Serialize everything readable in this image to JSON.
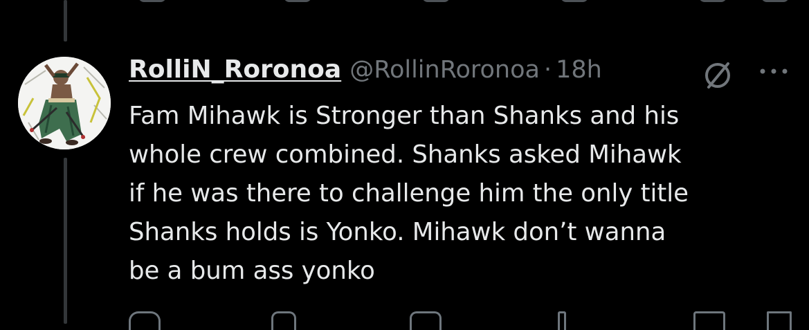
{
  "tweet": {
    "display_name": "RolliN_Roronoa",
    "handle": "@RollinRoronoa",
    "separator": "·",
    "time": "18h",
    "text": "Fam Mihawk is Stronger than Shanks and his\nwhole crew combined. Shanks asked Mihawk\nif he was there to challenge him the only title\nShanks holds is Yonko. Mihawk don’t wanna\nbe a bum ass yonko",
    "more_label": "More"
  },
  "colors": {
    "background": "#000000",
    "text_primary": "#e7e9ea",
    "text_secondary": "#71767b",
    "thread_line": "#333639"
  },
  "icons": {
    "verified": "slashed-circle-icon",
    "more": "more-dots-icon",
    "reply": "reply-icon",
    "retweet": "retweet-icon",
    "like": "like-icon",
    "views": "views-icon",
    "bookmark": "bookmark-icon",
    "share": "share-icon"
  }
}
